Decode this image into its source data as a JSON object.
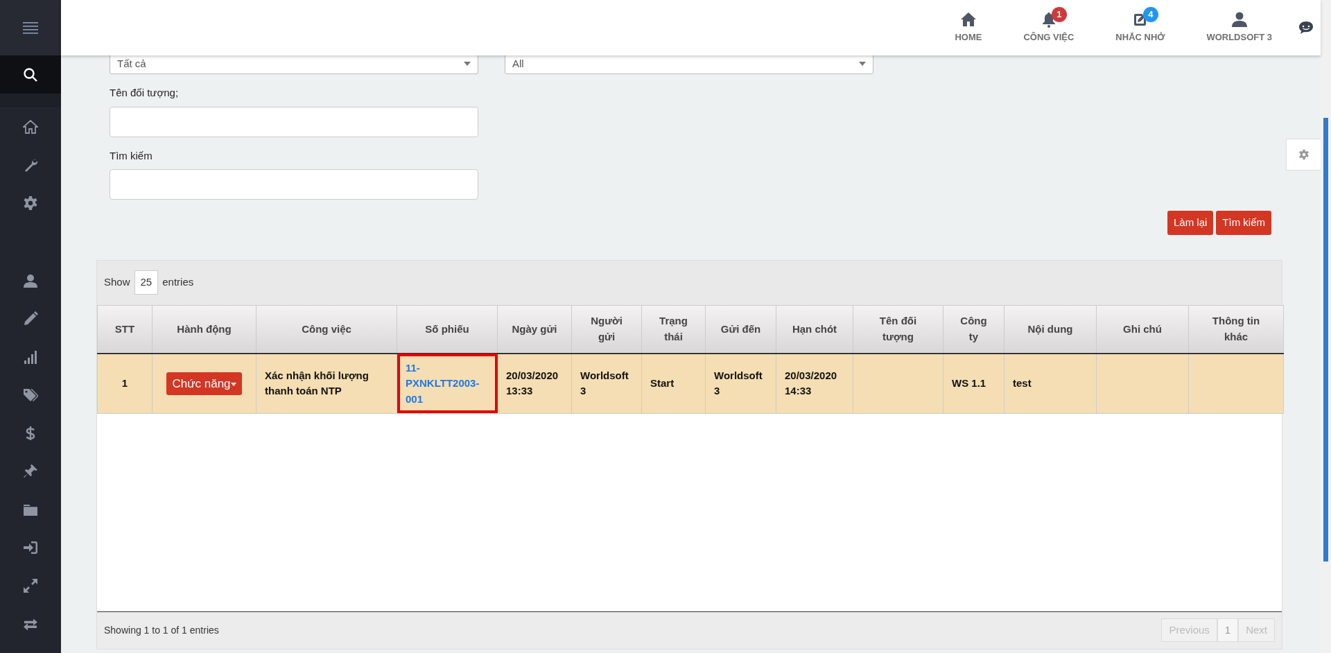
{
  "sidebar": {
    "search_selected": true
  },
  "topnav": [
    {
      "label": "HOME"
    },
    {
      "label": "CÔNG VIỆC",
      "badge": "1",
      "color": "#d0393b"
    },
    {
      "label": "NHẮC NHỞ",
      "badge": "4",
      "color": "#2196f3"
    },
    {
      "label": "WORLDSOFT 3"
    }
  ],
  "filters": {
    "selects": [
      {
        "value": "Tất cả"
      },
      {
        "value": "All"
      }
    ],
    "fields": [
      {
        "label": "Tên đối tượng;"
      },
      {
        "label": "Tìm kiếm"
      }
    ],
    "buttons": [
      "Làm lại",
      "Tìm kiếm"
    ]
  },
  "table": {
    "length": {
      "before": "Show",
      "value": "25",
      "after": "entries"
    },
    "columns": [
      "STT",
      "Hành động",
      "Công việc",
      "Số phiếu",
      "Ngày gửi",
      "Người gửi",
      "Trạng thái",
      "Gửi đến",
      "Hạn chót",
      "Tên đối tượng",
      "Công ty",
      "Nội dung",
      "Ghi chú",
      "Thông tin khác"
    ],
    "rows": [
      {
        "cells": [
          {
            "kind": "text",
            "text": "1",
            "highlighted": false
          },
          {
            "kind": "action",
            "text": "Chức năng",
            "highlighted": false
          },
          {
            "kind": "text",
            "text": "Xác nhận khối lượng thanh toán NTP",
            "highlighted": false
          },
          {
            "kind": "link",
            "text": "11-PXNKLTT2003-001",
            "highlighted": true
          },
          {
            "kind": "text",
            "text": "20/03/2020 13:33",
            "highlighted": false
          },
          {
            "kind": "text",
            "text": "Worldsoft 3",
            "highlighted": false
          },
          {
            "kind": "text",
            "text": "Start",
            "highlighted": false
          },
          {
            "kind": "text",
            "text": "Worldsoft 3",
            "highlighted": false
          },
          {
            "kind": "text",
            "text": "20/03/2020 14:33",
            "highlighted": false
          },
          {
            "kind": "text",
            "highlighted": false
          },
          {
            "kind": "text",
            "text": "WS 1.1",
            "highlighted": false
          },
          {
            "kind": "text",
            "text": "test",
            "highlighted": false
          },
          {
            "kind": "text",
            "highlighted": false
          },
          {
            "kind": "text",
            "highlighted": false
          }
        ]
      }
    ],
    "info": "Showing 1 to 1 of 1 entries",
    "pagination": [
      {
        "label": "Previous",
        "selected": false,
        "disabled": true
      },
      {
        "label": "1",
        "selected": true,
        "disabled": false
      },
      {
        "label": "Next",
        "selected": false,
        "disabled": true
      }
    ]
  }
}
